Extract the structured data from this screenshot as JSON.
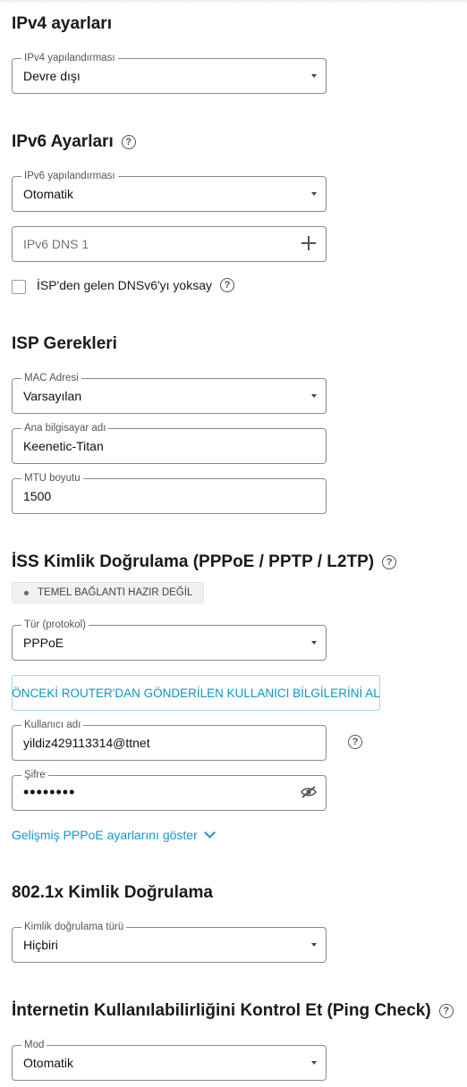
{
  "ipv4": {
    "heading": "IPv4 ayarları",
    "config_label": "IPv4 yapılandırması",
    "config_value": "Devre dışı"
  },
  "ipv6": {
    "heading": "IPv6 Ayarları",
    "config_label": "IPv6 yapılandırması",
    "config_value": "Otomatik",
    "dns_placeholder": "IPv6 DNS 1",
    "ignore_dns_label": "İSP'den gelen DNSv6'yı yoksay",
    "ignore_dns_checked": false
  },
  "isp": {
    "heading": "ISP Gerekleri",
    "mac_label": "MAC Adresi",
    "mac_value": "Varsayılan",
    "hostname_label": "Ana bilgisayar adı",
    "hostname_value": "Keenetic-Titan",
    "mtu_label": "MTU boyutu",
    "mtu_value": "1500"
  },
  "auth": {
    "heading": "İSS Kimlik Doğrulama (PPPoE / PPTP / L2TP)",
    "status": "TEMEL BAĞLANTI HAZIR DEĞİL",
    "protocol_label": "Tür (protokol)",
    "protocol_value": "PPPoE",
    "fetch_button": "ÖNCEKİ ROUTER'DAN GÖNDERİLEN KULLANICI BİLGİLERİNİ AL",
    "username_label": "Kullanıcı adı",
    "username_value": "yildiz429113314@ttnet",
    "password_label": "Şifre",
    "password_masked": "••••••••",
    "advanced_link": "Gelişmiş PPPoE ayarlarını göster"
  },
  "dot1x": {
    "heading": "802.1x Kimlik Doğrulama",
    "type_label": "Kimlik doğrulama türü",
    "type_value": "Hiçbiri"
  },
  "pingcheck": {
    "heading": "İnternetin Kullanılabilirliğini Kontrol Et (Ping Check)",
    "mode_label": "Mod",
    "mode_value": "Otomatik"
  },
  "icons": {
    "help": "question-circle-icon",
    "dropdown": "caret-down-icon",
    "add": "plus-icon",
    "password_visibility": "eye-off-icon",
    "expand": "chevron-down-icon"
  }
}
